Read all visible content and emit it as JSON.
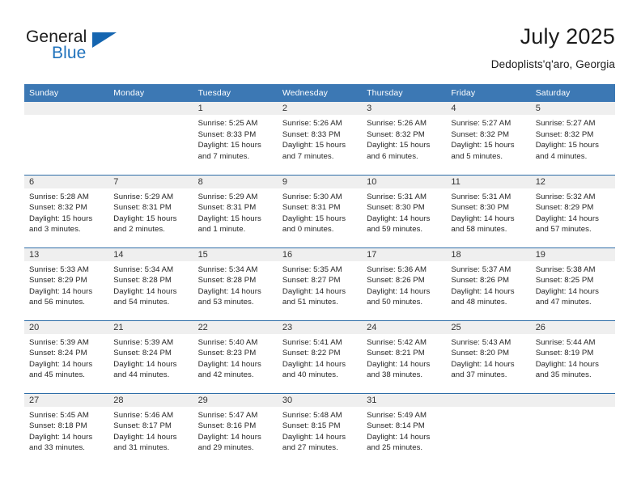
{
  "brand": {
    "name_top": "General",
    "name_bottom": "Blue",
    "triangle_color": "#1565b0",
    "blue_text_color": "#1f72bc"
  },
  "header": {
    "title": "July 2025",
    "subtitle": "Dedoplists'q'aro, Georgia"
  },
  "theme": {
    "header_bg": "#3c78b4",
    "row_divider": "#2f6ea8",
    "daynum_bg": "#efefef",
    "text": "#262626"
  },
  "calendar": {
    "weekday_headers": [
      "Sunday",
      "Monday",
      "Tuesday",
      "Wednesday",
      "Thursday",
      "Friday",
      "Saturday"
    ],
    "weeks": [
      [
        {
          "day": "",
          "lines": []
        },
        {
          "day": "",
          "lines": []
        },
        {
          "day": "1",
          "lines": [
            "Sunrise: 5:25 AM",
            "Sunset: 8:33 PM",
            "Daylight: 15 hours",
            "and 7 minutes."
          ]
        },
        {
          "day": "2",
          "lines": [
            "Sunrise: 5:26 AM",
            "Sunset: 8:33 PM",
            "Daylight: 15 hours",
            "and 7 minutes."
          ]
        },
        {
          "day": "3",
          "lines": [
            "Sunrise: 5:26 AM",
            "Sunset: 8:32 PM",
            "Daylight: 15 hours",
            "and 6 minutes."
          ]
        },
        {
          "day": "4",
          "lines": [
            "Sunrise: 5:27 AM",
            "Sunset: 8:32 PM",
            "Daylight: 15 hours",
            "and 5 minutes."
          ]
        },
        {
          "day": "5",
          "lines": [
            "Sunrise: 5:27 AM",
            "Sunset: 8:32 PM",
            "Daylight: 15 hours",
            "and 4 minutes."
          ]
        }
      ],
      [
        {
          "day": "6",
          "lines": [
            "Sunrise: 5:28 AM",
            "Sunset: 8:32 PM",
            "Daylight: 15 hours",
            "and 3 minutes."
          ]
        },
        {
          "day": "7",
          "lines": [
            "Sunrise: 5:29 AM",
            "Sunset: 8:31 PM",
            "Daylight: 15 hours",
            "and 2 minutes."
          ]
        },
        {
          "day": "8",
          "lines": [
            "Sunrise: 5:29 AM",
            "Sunset: 8:31 PM",
            "Daylight: 15 hours",
            "and 1 minute."
          ]
        },
        {
          "day": "9",
          "lines": [
            "Sunrise: 5:30 AM",
            "Sunset: 8:31 PM",
            "Daylight: 15 hours",
            "and 0 minutes."
          ]
        },
        {
          "day": "10",
          "lines": [
            "Sunrise: 5:31 AM",
            "Sunset: 8:30 PM",
            "Daylight: 14 hours",
            "and 59 minutes."
          ]
        },
        {
          "day": "11",
          "lines": [
            "Sunrise: 5:31 AM",
            "Sunset: 8:30 PM",
            "Daylight: 14 hours",
            "and 58 minutes."
          ]
        },
        {
          "day": "12",
          "lines": [
            "Sunrise: 5:32 AM",
            "Sunset: 8:29 PM",
            "Daylight: 14 hours",
            "and 57 minutes."
          ]
        }
      ],
      [
        {
          "day": "13",
          "lines": [
            "Sunrise: 5:33 AM",
            "Sunset: 8:29 PM",
            "Daylight: 14 hours",
            "and 56 minutes."
          ]
        },
        {
          "day": "14",
          "lines": [
            "Sunrise: 5:34 AM",
            "Sunset: 8:28 PM",
            "Daylight: 14 hours",
            "and 54 minutes."
          ]
        },
        {
          "day": "15",
          "lines": [
            "Sunrise: 5:34 AM",
            "Sunset: 8:28 PM",
            "Daylight: 14 hours",
            "and 53 minutes."
          ]
        },
        {
          "day": "16",
          "lines": [
            "Sunrise: 5:35 AM",
            "Sunset: 8:27 PM",
            "Daylight: 14 hours",
            "and 51 minutes."
          ]
        },
        {
          "day": "17",
          "lines": [
            "Sunrise: 5:36 AM",
            "Sunset: 8:26 PM",
            "Daylight: 14 hours",
            "and 50 minutes."
          ]
        },
        {
          "day": "18",
          "lines": [
            "Sunrise: 5:37 AM",
            "Sunset: 8:26 PM",
            "Daylight: 14 hours",
            "and 48 minutes."
          ]
        },
        {
          "day": "19",
          "lines": [
            "Sunrise: 5:38 AM",
            "Sunset: 8:25 PM",
            "Daylight: 14 hours",
            "and 47 minutes."
          ]
        }
      ],
      [
        {
          "day": "20",
          "lines": [
            "Sunrise: 5:39 AM",
            "Sunset: 8:24 PM",
            "Daylight: 14 hours",
            "and 45 minutes."
          ]
        },
        {
          "day": "21",
          "lines": [
            "Sunrise: 5:39 AM",
            "Sunset: 8:24 PM",
            "Daylight: 14 hours",
            "and 44 minutes."
          ]
        },
        {
          "day": "22",
          "lines": [
            "Sunrise: 5:40 AM",
            "Sunset: 8:23 PM",
            "Daylight: 14 hours",
            "and 42 minutes."
          ]
        },
        {
          "day": "23",
          "lines": [
            "Sunrise: 5:41 AM",
            "Sunset: 8:22 PM",
            "Daylight: 14 hours",
            "and 40 minutes."
          ]
        },
        {
          "day": "24",
          "lines": [
            "Sunrise: 5:42 AM",
            "Sunset: 8:21 PM",
            "Daylight: 14 hours",
            "and 38 minutes."
          ]
        },
        {
          "day": "25",
          "lines": [
            "Sunrise: 5:43 AM",
            "Sunset: 8:20 PM",
            "Daylight: 14 hours",
            "and 37 minutes."
          ]
        },
        {
          "day": "26",
          "lines": [
            "Sunrise: 5:44 AM",
            "Sunset: 8:19 PM",
            "Daylight: 14 hours",
            "and 35 minutes."
          ]
        }
      ],
      [
        {
          "day": "27",
          "lines": [
            "Sunrise: 5:45 AM",
            "Sunset: 8:18 PM",
            "Daylight: 14 hours",
            "and 33 minutes."
          ]
        },
        {
          "day": "28",
          "lines": [
            "Sunrise: 5:46 AM",
            "Sunset: 8:17 PM",
            "Daylight: 14 hours",
            "and 31 minutes."
          ]
        },
        {
          "day": "29",
          "lines": [
            "Sunrise: 5:47 AM",
            "Sunset: 8:16 PM",
            "Daylight: 14 hours",
            "and 29 minutes."
          ]
        },
        {
          "day": "30",
          "lines": [
            "Sunrise: 5:48 AM",
            "Sunset: 8:15 PM",
            "Daylight: 14 hours",
            "and 27 minutes."
          ]
        },
        {
          "day": "31",
          "lines": [
            "Sunrise: 5:49 AM",
            "Sunset: 8:14 PM",
            "Daylight: 14 hours",
            "and 25 minutes."
          ]
        },
        {
          "day": "",
          "lines": []
        },
        {
          "day": "",
          "lines": []
        }
      ]
    ]
  }
}
